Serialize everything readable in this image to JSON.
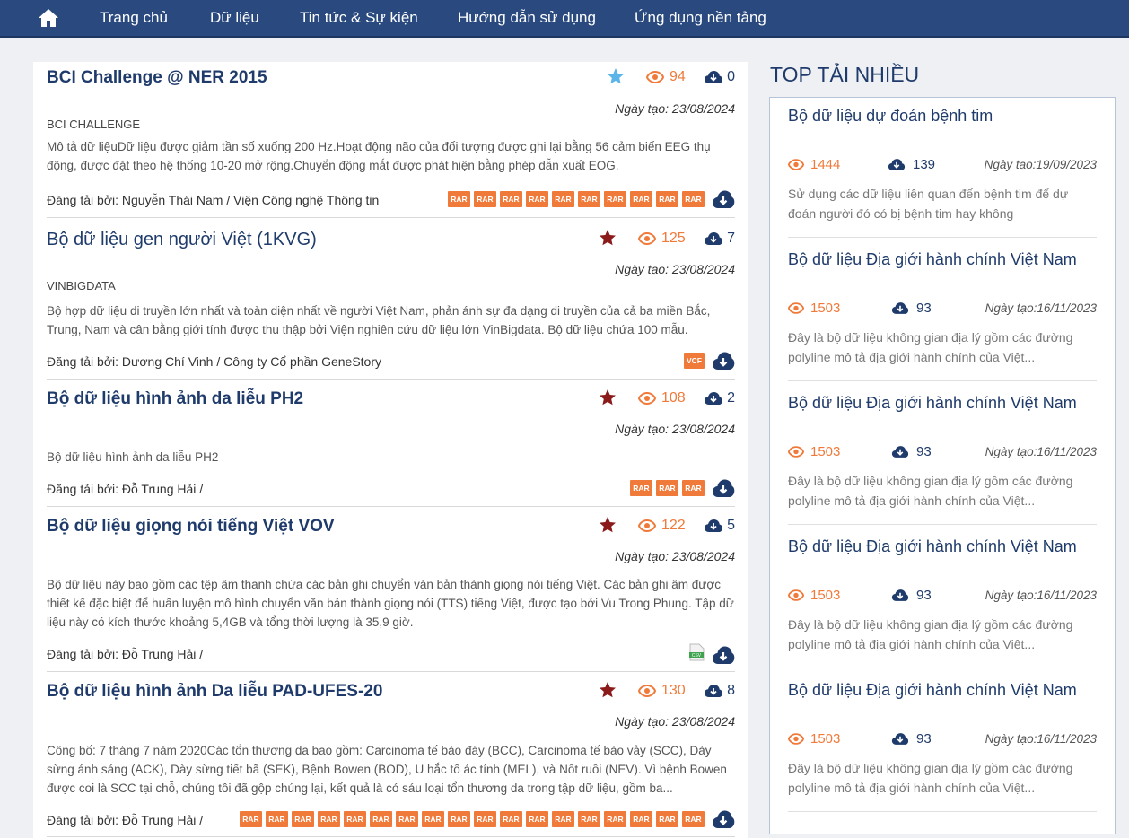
{
  "nav": {
    "items": [
      "Trang chủ",
      "Dữ liệu",
      "Tin tức & Sự kiện",
      "Hướng dẫn sử dụng",
      "Ứng dụng nền tảng"
    ]
  },
  "colors": {
    "nav_bg": "#2a4a7f",
    "accent": "#f07a3a",
    "title": "#1f3b6b",
    "star_filled": "#8b1a1a",
    "star_light": "#5bb5e8"
  },
  "datasets": [
    {
      "title": "BCI Challenge @ NER 2015",
      "star": "light",
      "views": "94",
      "downloads": "0",
      "date": "Ngày tạo: 23/08/2024",
      "org": "BCI CHALLENGE",
      "desc": "Mô tả dữ liệuDữ liệu được giảm tần số xuống 200 Hz.Hoạt động não của đối tượng được ghi lại bằng 56 cảm biến EEG thụ động, được đặt theo hệ thống 10-20 mở rộng.Chuyển động mắt được phát hiện bằng phép dẫn xuất EOG.",
      "uploader": "Đăng tải bởi: Nguyễn Thái Nam / Viện Công nghệ Thông tin",
      "files": [
        "RAR",
        "RAR",
        "RAR",
        "RAR",
        "RAR",
        "RAR",
        "RAR",
        "RAR",
        "RAR",
        "RAR"
      ]
    },
    {
      "title": "Bộ dữ liệu gen người Việt (1KVG)",
      "star": "filled",
      "views": "125",
      "downloads": "7",
      "date": "Ngày tạo: 23/08/2024",
      "org": "VINBIGDATA",
      "desc": "Bộ hợp dữ liệu di truyền lớn nhất và toàn diện nhất về người Việt Nam, phản ánh  sự đa dạng di truyền của cả ba miền Bắc, Trung, Nam và cân bằng giới tính được thu thập bởi Viện nghiên cứu dữ liệu lớn VinBigdata. Bộ dữ liệu chứa 100 mẫu.",
      "uploader": "Đăng tải bởi: Dương Chí Vinh / Công ty Cổ phần GeneStory",
      "files": [
        "VCF"
      ]
    },
    {
      "title": "Bộ dữ liệu hình ảnh da liễu PH2",
      "star": "filled",
      "views": "108",
      "downloads": "2",
      "date": "Ngày tạo: 23/08/2024",
      "org": "",
      "desc": "Bộ dữ liệu hình ảnh da liễu PH2",
      "uploader": "Đăng tải bởi: Đỗ Trung Hải /",
      "files": [
        "RAR",
        "RAR",
        "RAR"
      ]
    },
    {
      "title": "Bộ dữ liệu giọng nói tiếng Việt VOV",
      "star": "filled",
      "views": "122",
      "downloads": "5",
      "date": "Ngày tạo: 23/08/2024",
      "org": "",
      "desc": "Bộ dữ liệu này bao gồm các tệp âm thanh chứa các bản ghi chuyển văn bản thành giọng nói tiếng Việt. Các bản ghi âm được thiết kế đặc biệt để huấn luyện mô hình chuyển văn bản thành giọng nói (TTS) tiếng Việt, được tạo bởi Vu Trong Phung. Tập dữ liệu này có kích thước khoảng 5,4GB và tổng thời lượng là 35,9 giờ.",
      "uploader": "Đăng tải bởi: Đỗ Trung Hải /",
      "files": [
        "CSV"
      ]
    },
    {
      "title": "Bộ dữ liệu hình ảnh Da liễu PAD-UFES-20",
      "star": "filled",
      "views": "130",
      "downloads": "8",
      "date": "Ngày tạo: 23/08/2024",
      "org": "",
      "desc": "Công bố: 7 tháng 7 năm 2020Các tổn thương da bao gồm: Carcinoma tế bào đáy (BCC), Carcinoma tế bào vảy (SCC), Dày sừng ánh sáng (ACK), Dày sừng tiết bã (SEK), Bệnh Bowen (BOD), U hắc tố ác tính (MEL), và Nốt ruồi (NEV). Vì bệnh Bowen được coi là SCC tại chỗ, chúng tôi đã gộp chúng lại, kết quả là có sáu loại tổn thương da trong tập dữ liệu, gồm ba...",
      "uploader": "Đăng tải bởi: Đỗ Trung Hải /",
      "files": [
        "RAR",
        "RAR",
        "RAR",
        "RAR",
        "RAR",
        "RAR",
        "RAR",
        "RAR",
        "RAR",
        "RAR",
        "RAR",
        "RAR",
        "RAR",
        "RAR",
        "RAR",
        "RAR",
        "RAR",
        "RAR"
      ]
    }
  ],
  "sidebar": {
    "title": "TOP TẢI NHIỀU",
    "items": [
      {
        "title": "Bộ dữ liệu dự đoán bệnh tim",
        "views": "1444",
        "downloads": "139",
        "date": "Ngày tạo:19/09/2023",
        "desc": "Sử dụng các dữ liệu liên quan đến bệnh tim để dự đoán người đó có bị bệnh tim hay không"
      },
      {
        "title": "Bộ dữ liệu Địa giới hành chính Việt Nam",
        "views": "1503",
        "downloads": "93",
        "date": "Ngày tạo:16/11/2023",
        "desc": "Đây là bộ dữ liệu không gian địa lý gồm các đường polyline mô tả địa giới hành chính của Việt..."
      },
      {
        "title": "Bộ dữ liệu Địa giới hành chính Việt Nam",
        "views": "1503",
        "downloads": "93",
        "date": "Ngày tạo:16/11/2023",
        "desc": "Đây là bộ dữ liệu không gian địa lý gồm các đường polyline mô tả địa giới hành chính của Việt..."
      },
      {
        "title": "Bộ dữ liệu Địa giới hành chính Việt Nam",
        "views": "1503",
        "downloads": "93",
        "date": "Ngày tạo:16/11/2023",
        "desc": "Đây là bộ dữ liệu không gian địa lý gồm các đường polyline mô tả địa giới hành chính của Việt..."
      },
      {
        "title": "Bộ dữ liệu Địa giới hành chính Việt Nam",
        "views": "1503",
        "downloads": "93",
        "date": "Ngày tạo:16/11/2023",
        "desc": "Đây là bộ dữ liệu không gian địa lý gồm các đường polyline mô tả địa giới hành chính của Việt..."
      }
    ]
  }
}
